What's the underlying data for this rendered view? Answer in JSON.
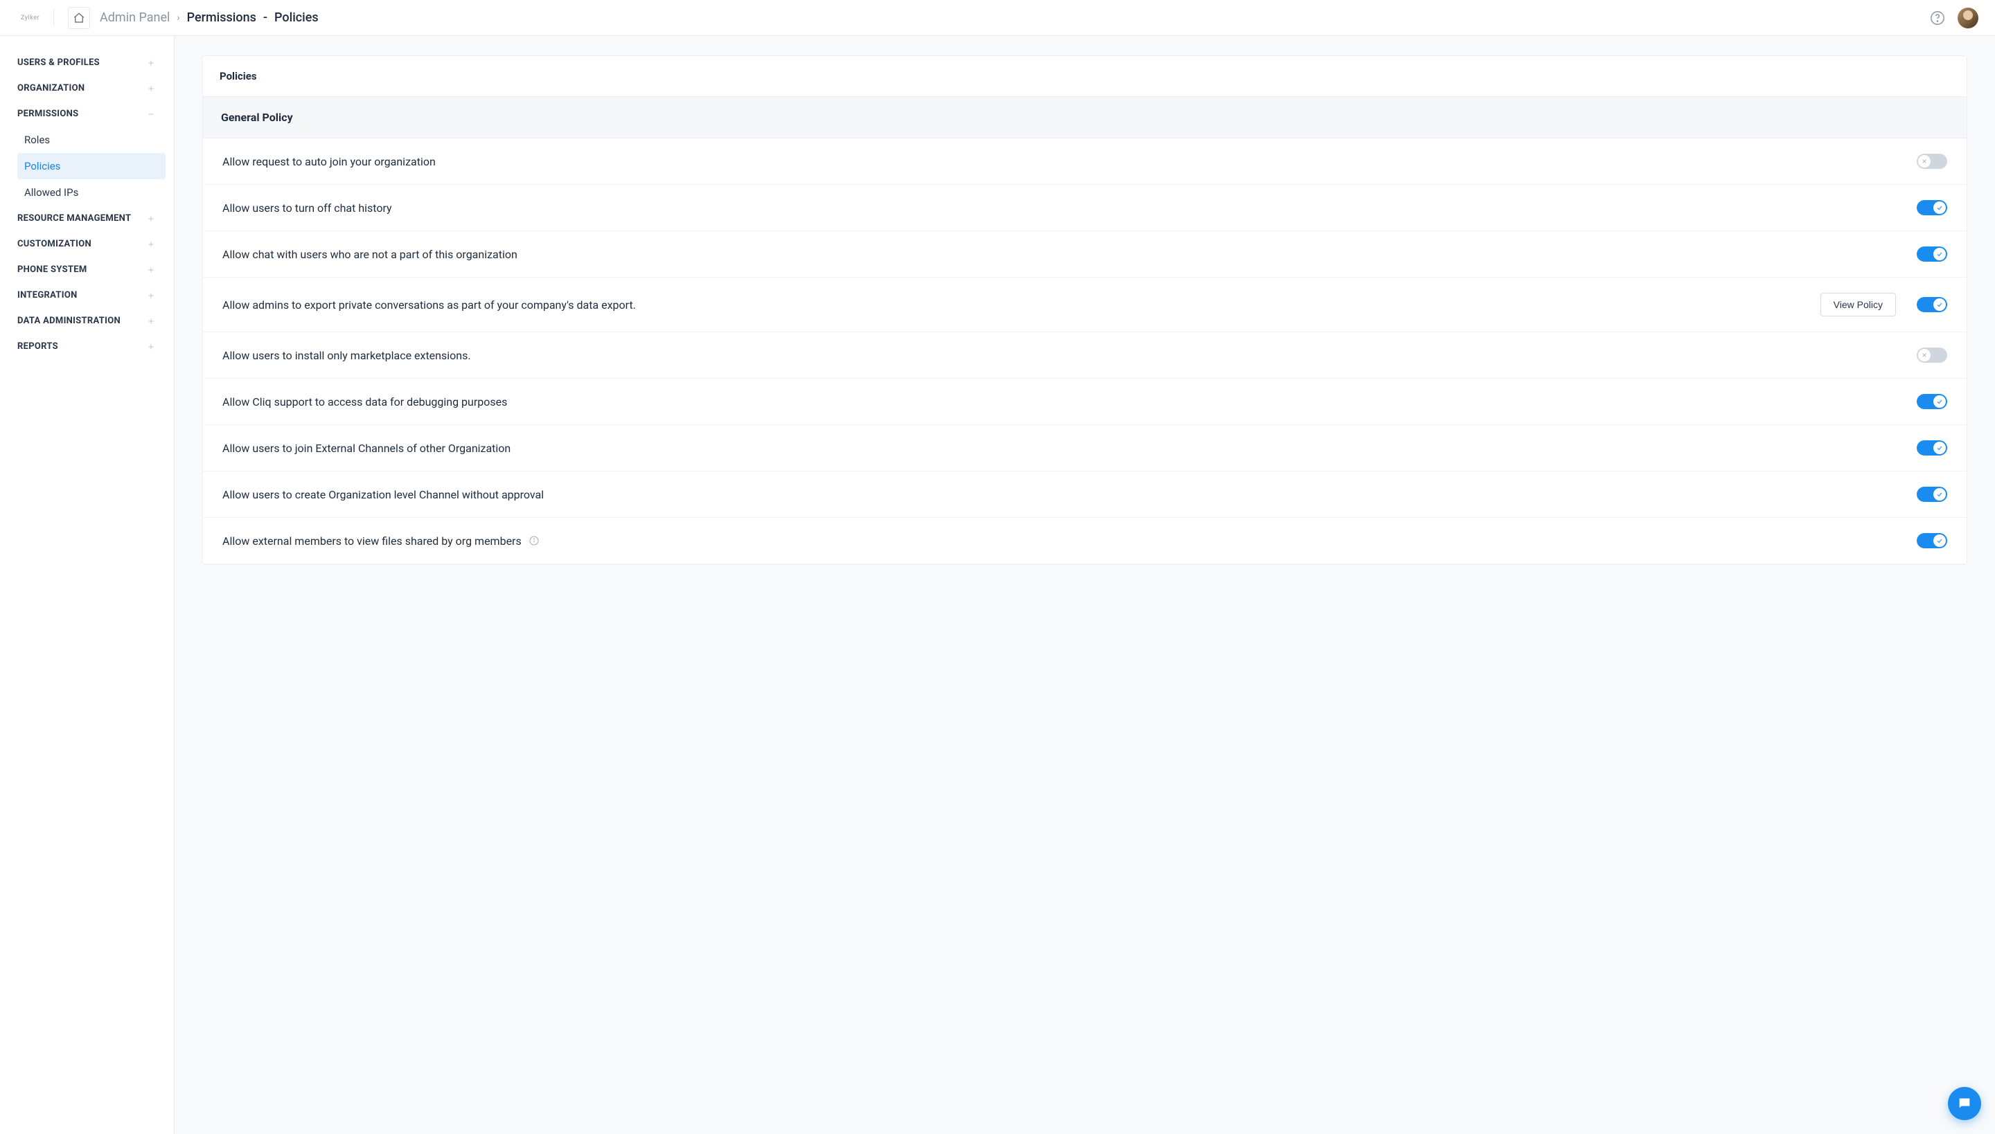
{
  "header": {
    "logo_text": "Zylker",
    "breadcrumb": {
      "root": "Admin Panel",
      "mid": "Permissions",
      "leaf": "Policies"
    }
  },
  "sidebar": {
    "sections": [
      {
        "label": "USERS & PROFILES",
        "expanded": false
      },
      {
        "label": "ORGANIZATION",
        "expanded": false
      },
      {
        "label": "PERMISSIONS",
        "expanded": true,
        "items": [
          {
            "label": "Roles",
            "active": false
          },
          {
            "label": "Policies",
            "active": true
          },
          {
            "label": "Allowed IPs",
            "active": false
          }
        ]
      },
      {
        "label": "RESOURCE MANAGEMENT",
        "expanded": false
      },
      {
        "label": "CUSTOMIZATION",
        "expanded": false
      },
      {
        "label": "PHONE SYSTEM",
        "expanded": false
      },
      {
        "label": "INTEGRATION",
        "expanded": false
      },
      {
        "label": "DATA ADMINISTRATION",
        "expanded": false
      },
      {
        "label": "REPORTS",
        "expanded": false
      }
    ]
  },
  "main": {
    "card_title": "Policies",
    "section_title": "General Policy",
    "view_policy_label": "View Policy",
    "policies": [
      {
        "label": "Allow request to auto join your organization",
        "on": false,
        "hasButton": false,
        "hasInfo": false
      },
      {
        "label": "Allow users to turn off chat history",
        "on": true,
        "hasButton": false,
        "hasInfo": false
      },
      {
        "label": "Allow chat with users who are not a part of this organization",
        "on": true,
        "hasButton": false,
        "hasInfo": false
      },
      {
        "label": "Allow admins to export private conversations as part of your company's data export.",
        "on": true,
        "hasButton": true,
        "hasInfo": false
      },
      {
        "label": "Allow users to install only marketplace extensions.",
        "on": false,
        "hasButton": false,
        "hasInfo": false
      },
      {
        "label": "Allow Cliq support to access data for debugging purposes",
        "on": true,
        "hasButton": false,
        "hasInfo": false
      },
      {
        "label": "Allow users to join External Channels of other Organization",
        "on": true,
        "hasButton": false,
        "hasInfo": false
      },
      {
        "label": "Allow users to create Organization level Channel without approval",
        "on": true,
        "hasButton": false,
        "hasInfo": false
      },
      {
        "label": "Allow external members to view files shared by org members",
        "on": true,
        "hasButton": false,
        "hasInfo": true
      }
    ]
  }
}
